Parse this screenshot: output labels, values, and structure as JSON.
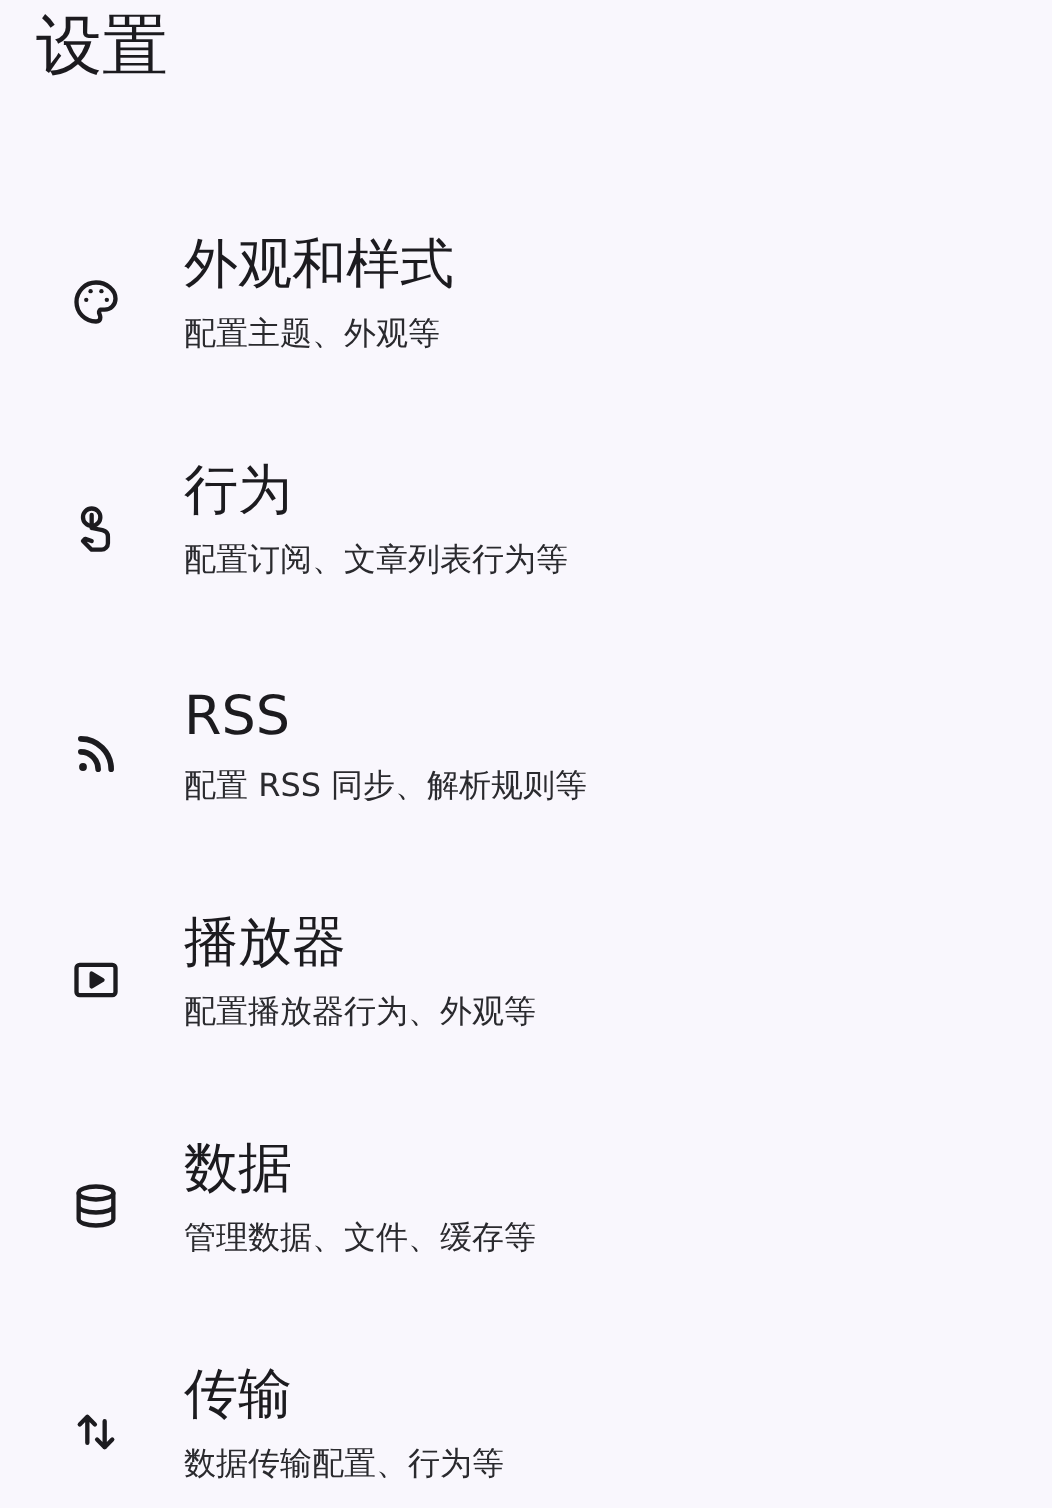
{
  "title": "设置",
  "items": [
    {
      "title": "外观和样式",
      "subtitle": "配置主题、外观等"
    },
    {
      "title": "行为",
      "subtitle": "配置订阅、文章列表行为等"
    },
    {
      "title": "RSS",
      "subtitle": "配置 RSS 同步、解析规则等"
    },
    {
      "title": "播放器",
      "subtitle": "配置播放器行为、外观等"
    },
    {
      "title": "数据",
      "subtitle": "管理数据、文件、缓存等"
    },
    {
      "title": "传输",
      "subtitle": "数据传输配置、行为等"
    }
  ]
}
